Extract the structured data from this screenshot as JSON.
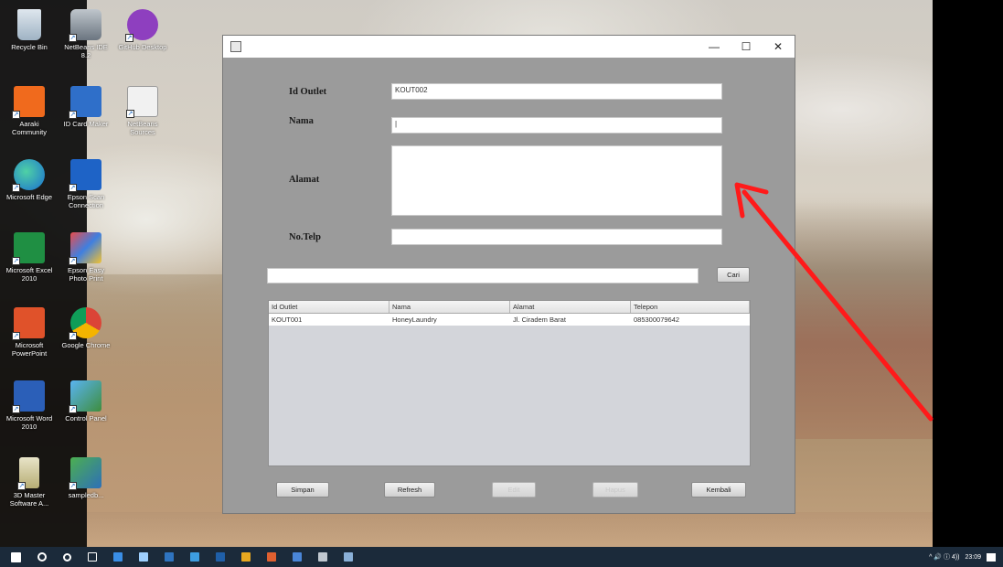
{
  "desktop": {
    "icons": [
      {
        "label": "Recycle Bin",
        "icon": "recycle-bin-icon"
      },
      {
        "label": "NetBeans IDE 8.2",
        "icon": "netbeans-icon"
      },
      {
        "label": "GitHub Desktop",
        "icon": "github-icon"
      },
      {
        "label": "Aaraki Community",
        "icon": "aaraki-icon"
      },
      {
        "label": "ID Card Maker",
        "icon": "network-icon"
      },
      {
        "label": "NetBeans Sources",
        "icon": "java-icon"
      },
      {
        "label": "Microsoft Edge",
        "icon": "edge-icon"
      },
      {
        "label": "Epson Scan Connection",
        "icon": "epson-icon"
      },
      {
        "label": "Microsoft Excel 2010",
        "icon": "excel-icon"
      },
      {
        "label": "Epson Easy Photo Print",
        "icon": "photo-icon"
      },
      {
        "label": "Microsoft PowerPoint",
        "icon": "powerpoint-icon"
      },
      {
        "label": "Google Chrome",
        "icon": "chrome-icon"
      },
      {
        "label": "Microsoft Word 2010",
        "icon": "word-icon"
      },
      {
        "label": "Control Panel",
        "icon": "control-panel-icon"
      },
      {
        "label": "3D Master Software A...",
        "icon": "3d-master-icon"
      },
      {
        "label": "sampledb...",
        "icon": "folder-icon"
      }
    ]
  },
  "window": {
    "buttons": {
      "minimize": "—",
      "maximize": "☐",
      "close": "✕"
    },
    "form": {
      "id_outlet_label": "Id Outlet",
      "id_outlet_value": "KOUT002",
      "nama_label": "Nama",
      "nama_value": "|",
      "alamat_label": "Alamat",
      "alamat_value": "",
      "notelp_label": "No.Telp",
      "notelp_value": ""
    },
    "search": {
      "value": "",
      "button_label": "Cari"
    },
    "table": {
      "columns": [
        "Id Outlet",
        "Nama",
        "Alamat",
        "Telepon"
      ],
      "rows": [
        [
          "KOUT001",
          "HoneyLaundry",
          "Jl. Ciradem Barat",
          "085300079642"
        ]
      ]
    },
    "actions": {
      "simpan": "Simpan",
      "refresh": "Refresh",
      "edit": "Edit",
      "hapus": "Hapus",
      "kembali": "Kembali"
    }
  },
  "taskbar": {
    "clock": "23:09",
    "tray_text": "^ 🔊 ⓘ 4))"
  },
  "colors": {
    "window_bg": "#9b9b9b",
    "arrow": "#ff1a1a",
    "taskbar": "#1b2a3a"
  }
}
